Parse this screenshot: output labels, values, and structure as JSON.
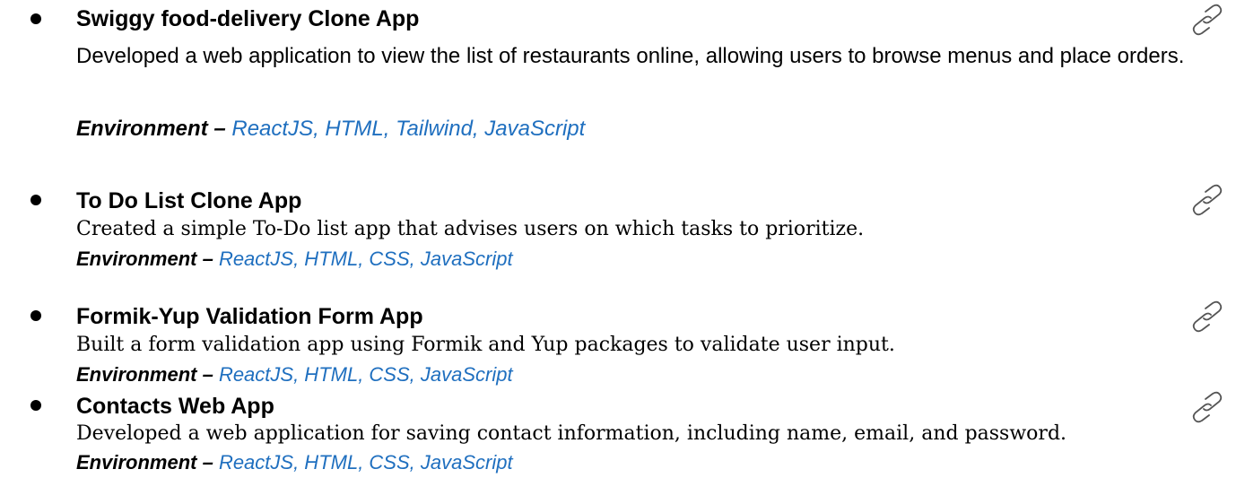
{
  "environment_label": "Environment –",
  "projects": [
    {
      "title": "Swiggy food-delivery Clone App",
      "description": "Developed a web application to view the list of restaurants online, allowing users to browse menus and place orders.",
      "stack": "ReactJS, HTML, Tailwind, JavaScript",
      "icon": "link-icon"
    },
    {
      "title": "To Do List Clone App",
      "description": "Created a simple To-Do list app that advises users on which tasks to prioritize.",
      "stack": "ReactJS, HTML, CSS, JavaScript",
      "icon": "link-icon"
    },
    {
      "title": "Formik-Yup Validation Form App",
      "description": "Built a form validation app using Formik and Yup packages to validate user input.",
      "stack": "ReactJS, HTML, CSS, JavaScript",
      "icon": "link-icon"
    },
    {
      "title": "Contacts Web App",
      "description": "Developed a web application for saving contact information, including name, email, and password.",
      "stack": "ReactJS, HTML, CSS, JavaScript",
      "icon": "link-icon"
    }
  ],
  "colors": {
    "text": "#000000",
    "stack": "#1f6fbf",
    "icon": "#555555"
  }
}
